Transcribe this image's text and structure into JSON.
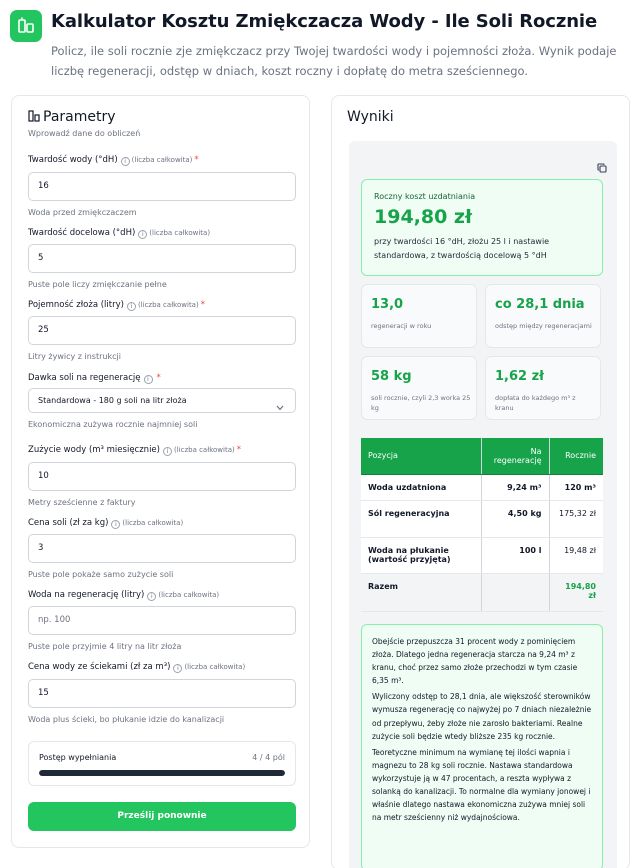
{
  "header": {
    "title": "Kalkulator Kosztu Zmiękczacza Wody - Ile Soli Rocznie",
    "description": "Policz, ile soli rocznie zje zmiękczacz przy Twojej twardości wody i pojemności złoża. Wynik podaje liczbę regeneracji, odstęp w dniach, koszt roczny i dopłatę do metra sześciennego."
  },
  "params": {
    "title": "Parametry",
    "subtitle": "Wprowadź dane do obliczeń",
    "fields": [
      {
        "label": "Twardość wody (°dH)",
        "hint": "(liczba całkowita)",
        "required": "*",
        "value": "16",
        "help": "Woda przed zmiękczaczem"
      },
      {
        "label": "Twardość docelowa (°dH)",
        "hint": "(liczba całkowita)",
        "required": "",
        "value": "5",
        "help": "Puste pole liczy zmiękczanie pełne"
      },
      {
        "label": "Pojemność złoża (litry)",
        "hint": "(liczba całkowita)",
        "required": "*",
        "value": "25",
        "help": "Litry żywicy z instrukcji"
      },
      {
        "label": "Dawka soli na regenerację",
        "hint": "",
        "required": "*",
        "value": "Standardowa - 180 g soli na litr złoża",
        "help": "Ekonomiczna zużywa rocznie najmniej soli"
      },
      {
        "label": "Zużycie wody (m³ miesięcznie)",
        "hint": "(liczba całkowita)",
        "required": "*",
        "value": "10",
        "help": "Metry sześcienne z faktury"
      },
      {
        "label": "Cena soli (zł za kg)",
        "hint": "(liczba całkowita)",
        "required": "",
        "value": "3",
        "help": "Puste pole pokaże samo zużycie soli"
      },
      {
        "label": "Woda na regenerację (litry)",
        "hint": "(liczba całkowita)",
        "required": "",
        "value": "np. 100",
        "help": "Puste pole przyjmie 4 litry na litr złoża"
      },
      {
        "label": "Cena wody ze ściekami (zł za m³)",
        "hint": "(liczba całkowita)",
        "required": "",
        "value": "15",
        "help": "Woda plus ścieki, bo płukanie idzie do kanalizacji"
      }
    ],
    "progress": {
      "label": "Postęp wypełniania",
      "count": "4 / 4 pól",
      "fraction": 1.0
    },
    "submit_label": "Prześlij ponownie"
  },
  "results": {
    "title": "Wyniki",
    "cost": {
      "label": "Roczny koszt uzdatniania",
      "value": "194,80 zł",
      "desc": "przy twardości 16 °dH, złożu 25 l i nastawie standardowa, z twardością docelową 5 °dH"
    },
    "stats": [
      {
        "value": "13,0",
        "label": "regeneracji w roku"
      },
      {
        "value": "co 28,1 dnia",
        "label": "odstęp między regeneracjami"
      },
      {
        "value": "58 kg",
        "label": "soli rocznie, czyli 2,3 worka 25 kg"
      },
      {
        "value": "1,62 zł",
        "label": "dopłata do każdego m³ z kranu"
      }
    ],
    "table": {
      "headers": [
        "Pozycja",
        "Na regenerację",
        "Rocznie"
      ],
      "rows": [
        [
          "Woda uzdatniona",
          "9,24 m³",
          "120 m³"
        ],
        [
          "Sól regeneracyjna",
          "4,50 kg",
          "175,32 zł"
        ],
        [
          "Woda na płukanie (wartość przyjęta)",
          "100 l",
          "19,48 zł"
        ]
      ],
      "total": [
        "Razem",
        "",
        "194,80 zł"
      ]
    },
    "notes": [
      "Obejście przepuszcza 31 procent wody z pominięciem złoża. Dlatego jedna regeneracja starcza na 9,24 m³ z kranu, choć przez samo złoże przechodzi w tym czasie 6,35 m³.",
      "Wyliczony odstęp to 28,1 dnia, ale większość sterowników wymusza regenerację co najwyżej po 7 dniach niezależnie od przepływu, żeby złoże nie zarosło bakteriami. Realne zużycie soli będzie wtedy bliższe 235 kg rocznie.",
      "Teoretyczne minimum na wymianę tej ilości wapnia i magnezu to 28 kg soli rocznie. Nastawa standardowa wykorzystuje ją w 47 procentach, a reszta wypływa z solanką do kanalizacji. To normalne dla wymiany jonowej i właśnie dlatego nastawa ekonomiczna zużywa mniej soli na metr sześcienny niż wydajnościowa."
    ]
  },
  "colors": {
    "accent": "#22c55e",
    "accent_dark": "#16a34a",
    "note_bg": "#f0fdf4"
  },
  "icons": [
    "app-logo-icon",
    "params-icon",
    "info-icon",
    "chevron-down-icon",
    "copy-icon"
  ]
}
